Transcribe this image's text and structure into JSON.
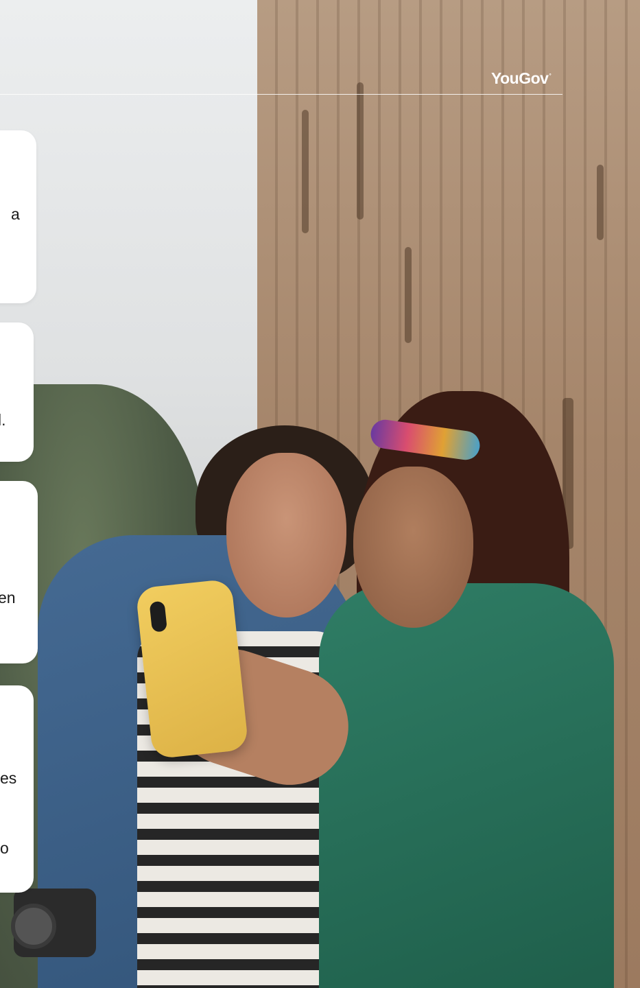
{
  "brand": {
    "logo_text": "YouGov",
    "logo_mark": "°"
  },
  "cards": [
    {
      "text": "a"
    },
    {
      "text": "l."
    },
    {
      "text": "en"
    },
    {
      "line1": "es",
      "line2": "o"
    }
  ],
  "colors": {
    "card_bg": "#ffffff",
    "text": "#1a1a1a",
    "logo": "#ffffff"
  }
}
